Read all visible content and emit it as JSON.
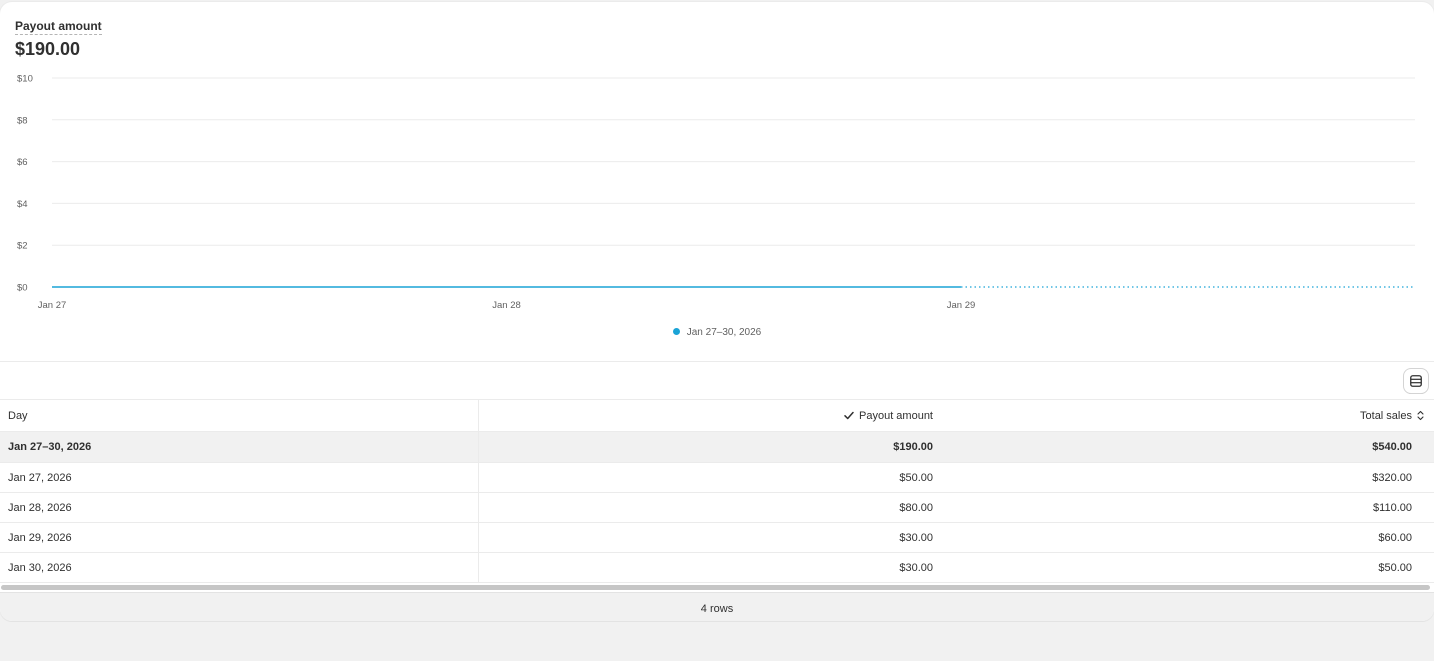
{
  "metric": {
    "title": "Payout amount",
    "value": "$190.00"
  },
  "chart_data": {
    "type": "line",
    "title": "",
    "xlabel": "",
    "ylabel": "",
    "ylim": [
      0,
      10
    ],
    "yticks": [
      "$0",
      "$2",
      "$4",
      "$6",
      "$8",
      "$10"
    ],
    "x": [
      "Jan 27",
      "Jan 28",
      "Jan 29",
      "Jan 30"
    ],
    "xtick_labels": [
      "Jan 27",
      "Jan 28",
      "Jan 29"
    ],
    "grid": true,
    "legend_position": "bottom-center",
    "series": [
      {
        "name": "Jan 27–30, 2026",
        "color": "#1aa3d6",
        "values": [
          0,
          0,
          0,
          0
        ],
        "projected_from_index": 2
      }
    ]
  },
  "toolbar": {
    "view_toggle_icon": "table-view-icon"
  },
  "table": {
    "columns": [
      {
        "label": "Day"
      },
      {
        "label": "Payout amount",
        "icon": "checkmark-icon"
      },
      {
        "label": "Total sales",
        "icon": "sort-icon"
      }
    ],
    "total_row": {
      "day": "Jan 27–30, 2026",
      "payout": "$190.00",
      "sales": "$540.00"
    },
    "rows": [
      {
        "day": "Jan 27, 2026",
        "payout": "$50.00",
        "sales": "$320.00"
      },
      {
        "day": "Jan 28, 2026",
        "payout": "$80.00",
        "sales": "$110.00"
      },
      {
        "day": "Jan 29, 2026",
        "payout": "$30.00",
        "sales": "$60.00"
      },
      {
        "day": "Jan 30, 2026",
        "payout": "$30.00",
        "sales": "$50.00"
      }
    ]
  },
  "footer": {
    "row_count": "4 rows"
  }
}
